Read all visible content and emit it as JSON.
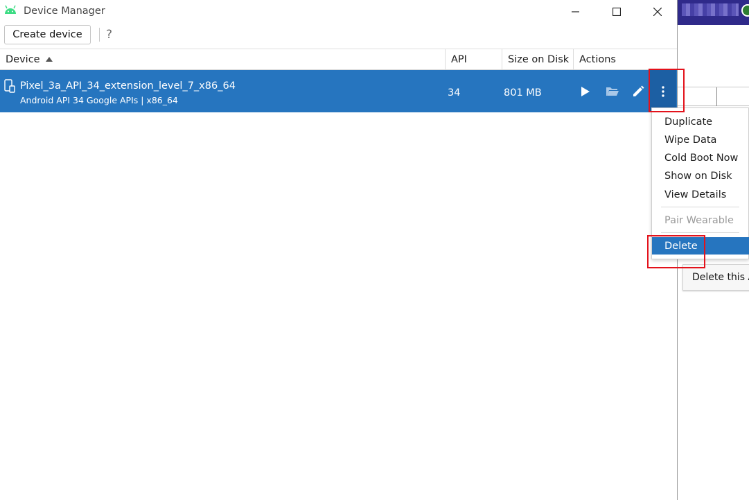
{
  "window": {
    "title": "Device Manager"
  },
  "toolbar": {
    "create_label": "Create device",
    "help_label": "?"
  },
  "table": {
    "columns": [
      "Device",
      "API",
      "Size on Disk",
      "Actions"
    ],
    "sort_column": "Device",
    "sort_direction": "ascending",
    "rows": [
      {
        "name": "Pixel_3a_API_34_extension_level_7_x86_64",
        "subtitle": "Android API 34 Google APIs | x86_64",
        "api": "34",
        "size": "801 MB",
        "selected": true,
        "actions": [
          "play-icon",
          "folder-icon",
          "edit-icon",
          "more-vertical-icon"
        ]
      }
    ]
  },
  "context_menu": {
    "items": [
      {
        "label": "Duplicate",
        "enabled": true
      },
      {
        "label": "Wipe Data",
        "enabled": true
      },
      {
        "label": "Cold Boot Now",
        "enabled": true
      },
      {
        "label": "Show on Disk",
        "enabled": true
      },
      {
        "label": "View Details",
        "enabled": true
      },
      {
        "label": "Pair Wearable",
        "enabled": false
      },
      {
        "label": "Delete",
        "enabled": true,
        "highlighted": true
      }
    ]
  },
  "tooltip": {
    "text": "Delete this A"
  },
  "colors": {
    "selection": "#2675bf",
    "highlight_box": "#e3121b",
    "android_green": "#3ddc84"
  }
}
